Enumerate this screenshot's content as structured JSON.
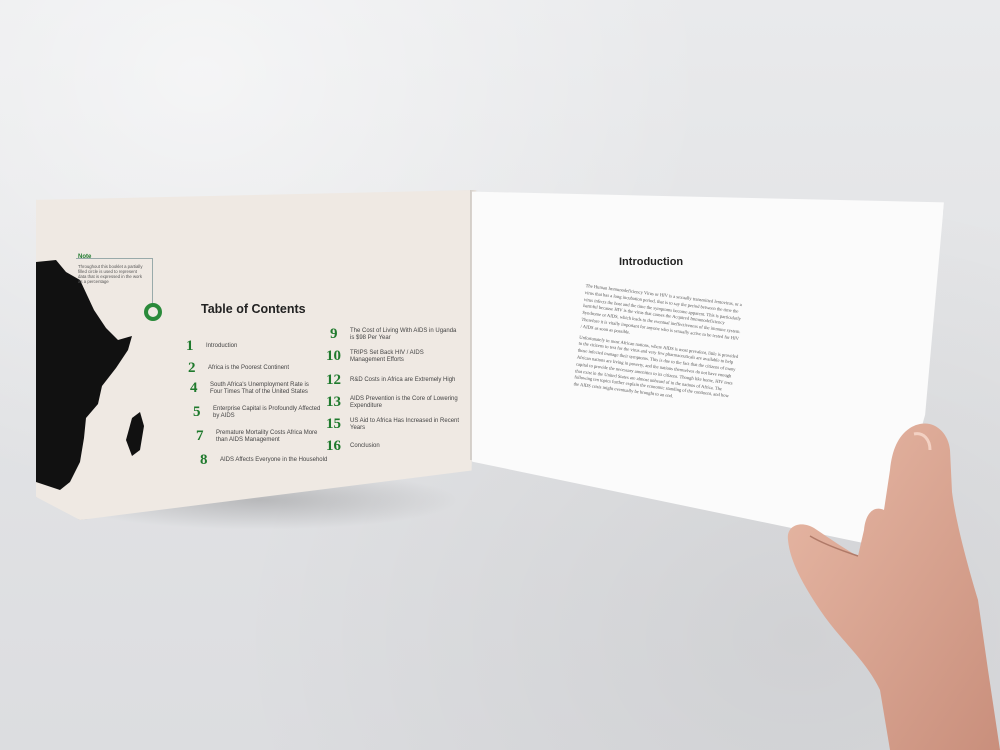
{
  "scene": "Open booklet held by a hand",
  "left_page": {
    "note": {
      "title": "Note",
      "text": "Throughout this booklet a partially filled circle is used to represent data that is expressed in the work as a percentage"
    },
    "toc_title": "Table of Contents",
    "toc": [
      {
        "num": "1",
        "label": "Introduction"
      },
      {
        "num": "2",
        "label": "Africa is the Poorest Continent"
      },
      {
        "num": "4",
        "label": "South Africa's Unemployment Rate is Four Times That of the United States"
      },
      {
        "num": "5",
        "label": "Enterprise Capital is Profoundly Affected by AIDS"
      },
      {
        "num": "7",
        "label": "Premature Mortality Costs Africa More than AIDS Management"
      },
      {
        "num": "8",
        "label": "AIDS Affects Everyone in the Household"
      },
      {
        "num": "9",
        "label": "The Cost of Living With AIDS in Uganda is $98 Per Year"
      },
      {
        "num": "10",
        "label": "TRIPS Set Back HIV / AIDS Management Efforts"
      },
      {
        "num": "12",
        "label": "R&D Costs in Africa are Extremely High"
      },
      {
        "num": "13",
        "label": "AIDS Prevention is the Core of Lowering Expenditure"
      },
      {
        "num": "15",
        "label": "US Aid to Africa Has Increased in Recent Years"
      },
      {
        "num": "16",
        "label": "Conclusion"
      }
    ]
  },
  "right_page": {
    "title": "Introduction",
    "paragraphs": [
      "The Human Immunodeficiency Virus or HIV is a sexually transmitted lentovirus, or a virus that has a long incubation period, that is to say the period between the time the virus infects the host and the time the symptoms become apparent. This is particularly harmful because HIV is the virus that causes the Acquired Immunodeficiency Syndrome or AIDS, which leads to the eventual ineffectiveness of the immune system. Therefore it is vitally important for anyone who is sexually active to be tested for HIV / AIDS as soon as possible.",
      "Unfortunately in most African nations, where AIDS is most prevalent, little is provided to the citizens to test for the virus and very few pharmaceuticals are available to help those infected manage their symptoms. This is due to the fact that the citizens of many African nations are living in poverty, and the nations themselves do not have enough capital to provide the necessary amenities to its citizens. Though like home, HIV tests that exist in the United States are almost unheard of in the nations of Africa. The following ten topics further explain the economic standing of the continent, and how the AIDS crisis might eventually be brought to an end."
    ]
  },
  "colors": {
    "accent": "#1f7a2d",
    "page_left": "#efe9e3",
    "page_right": "#fbfbfb",
    "background": "#e3e4e6"
  }
}
